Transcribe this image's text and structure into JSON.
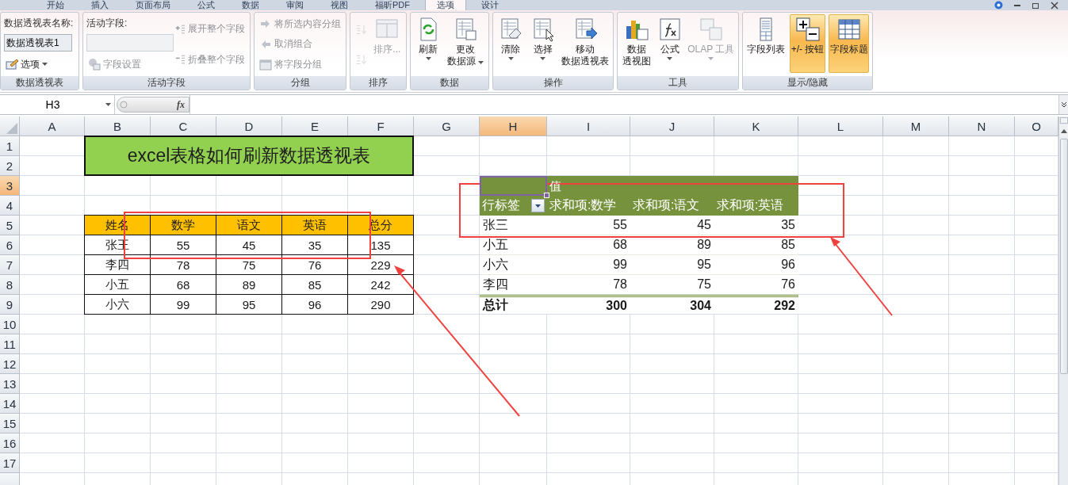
{
  "ribbon_tabs": [
    {
      "label": "开始",
      "selected": false
    },
    {
      "label": "插入",
      "selected": false
    },
    {
      "label": "页面布局",
      "selected": false
    },
    {
      "label": "公式",
      "selected": false
    },
    {
      "label": "数据",
      "selected": false
    },
    {
      "label": "审阅",
      "selected": false
    },
    {
      "label": "视图",
      "selected": false
    },
    {
      "label": "福昕PDF",
      "selected": false
    },
    {
      "label": "选项",
      "selected": true
    },
    {
      "label": "设计",
      "selected": false
    }
  ],
  "ribbon_groups": [
    {
      "title": "数据透视表",
      "columns": [
        [
          {
            "kind": "caption",
            "label": "数据透视表名称:"
          },
          {
            "kind": "field",
            "value": "数据透视表1",
            "disabled": false
          },
          {
            "kind": "small",
            "label": "选项",
            "dropdown": true,
            "disabled": false
          }
        ]
      ]
    },
    {
      "title": "活动字段",
      "columns": [
        [
          {
            "kind": "caption",
            "label": "活动字段:"
          },
          {
            "kind": "field",
            "disabled": true
          },
          {
            "kind": "small",
            "label": "字段设置",
            "dropdown": false,
            "disabled": true
          }
        ],
        [
          {
            "kind": "small",
            "label": "展开整个字段",
            "dropdown": false,
            "disabled": true
          },
          {
            "kind": "small",
            "label": "折叠整个字段",
            "dropdown": false,
            "disabled": true
          }
        ]
      ]
    },
    {
      "title": "分组",
      "columns": [
        [
          {
            "kind": "small",
            "label": "将所选内容分组",
            "dropdown": false,
            "disabled": true
          },
          {
            "kind": "small",
            "label": "取消组合",
            "dropdown": false,
            "disabled": true
          },
          {
            "kind": "small",
            "label": "将字段分组",
            "dropdown": false,
            "disabled": true
          }
        ]
      ]
    },
    {
      "title": "排序",
      "columns": [
        [
          {
            "kind": "icon",
            "disabled": true
          },
          {
            "kind": "icon",
            "disabled": true
          }
        ],
        [
          {
            "kind": "large",
            "lines": [
              "排序..."
            ],
            "dropdown": false,
            "disabled": true
          }
        ]
      ]
    },
    {
      "title": "数据",
      "columns": [
        [
          {
            "kind": "large",
            "lines": [
              "刷新"
            ],
            "dropdown": true,
            "disabled": false
          }
        ],
        [
          {
            "kind": "large",
            "lines": [
              "更改",
              "数据源"
            ],
            "dropdown": true,
            "disabled": false
          }
        ]
      ]
    },
    {
      "title": "操作",
      "columns": [
        [
          {
            "kind": "large",
            "lines": [
              "清除"
            ],
            "dropdown": true,
            "disabled": false
          }
        ],
        [
          {
            "kind": "large",
            "lines": [
              "选择"
            ],
            "dropdown": true,
            "disabled": false
          }
        ],
        [
          {
            "kind": "large",
            "lines": [
              "移动",
              "数据透视表"
            ],
            "dropdown": false,
            "disabled": false
          }
        ]
      ]
    },
    {
      "title": "工具",
      "columns": [
        [
          {
            "kind": "large",
            "lines": [
              "数据",
              "透视图"
            ],
            "dropdown": false,
            "disabled": false
          }
        ],
        [
          {
            "kind": "large",
            "lines": [
              "公式"
            ],
            "dropdown": true,
            "disabled": false
          }
        ],
        [
          {
            "kind": "large",
            "lines": [
              "OLAP 工具"
            ],
            "dropdown": true,
            "disabled": true
          }
        ]
      ]
    },
    {
      "title": "显示/隐藏",
      "columns": [
        [
          {
            "kind": "large",
            "lines": [
              "字段列表"
            ],
            "dropdown": false,
            "disabled": false,
            "selected": false
          }
        ],
        [
          {
            "kind": "large",
            "lines": [
              "+/- 按钮"
            ],
            "dropdown": false,
            "disabled": false,
            "selected": true
          }
        ],
        [
          {
            "kind": "large",
            "lines": [
              "字段标题"
            ],
            "dropdown": false,
            "disabled": false,
            "selected": true
          }
        ]
      ]
    }
  ],
  "formula_bar": {
    "name_box": "H3",
    "fx_label": "fx"
  },
  "sheet": {
    "columns": [
      {
        "label": "A",
        "selected": false
      },
      {
        "label": "B",
        "selected": false
      },
      {
        "label": "C",
        "selected": false
      },
      {
        "label": "D",
        "selected": false
      },
      {
        "label": "E",
        "selected": false
      },
      {
        "label": "F",
        "selected": false
      },
      {
        "label": "G",
        "selected": false
      },
      {
        "label": "H",
        "selected": true
      },
      {
        "label": "I",
        "selected": false
      },
      {
        "label": "J",
        "selected": false
      },
      {
        "label": "K",
        "selected": false
      },
      {
        "label": "L",
        "selected": false
      },
      {
        "label": "M",
        "selected": false
      },
      {
        "label": "N",
        "selected": false
      },
      {
        "label": "O",
        "selected": false
      }
    ],
    "rows": [
      {
        "label": "1",
        "selected": false
      },
      {
        "label": "2",
        "selected": false
      },
      {
        "label": "3",
        "selected": true
      },
      {
        "label": "4",
        "selected": false
      },
      {
        "label": "5",
        "selected": false
      },
      {
        "label": "6",
        "selected": false
      },
      {
        "label": "7",
        "selected": false
      },
      {
        "label": "8",
        "selected": false
      },
      {
        "label": "9",
        "selected": false
      },
      {
        "label": "10",
        "selected": false
      },
      {
        "label": "11",
        "selected": false
      },
      {
        "label": "12",
        "selected": false
      },
      {
        "label": "13",
        "selected": false
      },
      {
        "label": "14",
        "selected": false
      },
      {
        "label": "15",
        "selected": false
      },
      {
        "label": "16",
        "selected": false
      },
      {
        "label": "17",
        "selected": false
      }
    ],
    "title": "excel表格如何刷新数据透视表",
    "source_table": {
      "header": [
        "姓名",
        "数学",
        "语文",
        "英语",
        "总分"
      ],
      "rows": [
        [
          "张王",
          "55",
          "45",
          "35",
          "135"
        ],
        [
          "李四",
          "78",
          "75",
          "76",
          "229"
        ],
        [
          "小五",
          "68",
          "89",
          "85",
          "242"
        ],
        [
          "小六",
          "99",
          "95",
          "96",
          "290"
        ]
      ]
    },
    "pivot_table": {
      "corner_selected": true,
      "values_label": "值",
      "header": [
        "行标签",
        "求和项:数学",
        "求和项:语文",
        "求和项:英语"
      ],
      "rows": [
        [
          "张三",
          "55",
          "45",
          "35"
        ],
        [
          "小五",
          "68",
          "89",
          "85"
        ],
        [
          "小六",
          "99",
          "95",
          "96"
        ],
        [
          "李四",
          "78",
          "75",
          "76"
        ]
      ],
      "total": [
        "总计",
        "300",
        "304",
        "292"
      ]
    }
  }
}
